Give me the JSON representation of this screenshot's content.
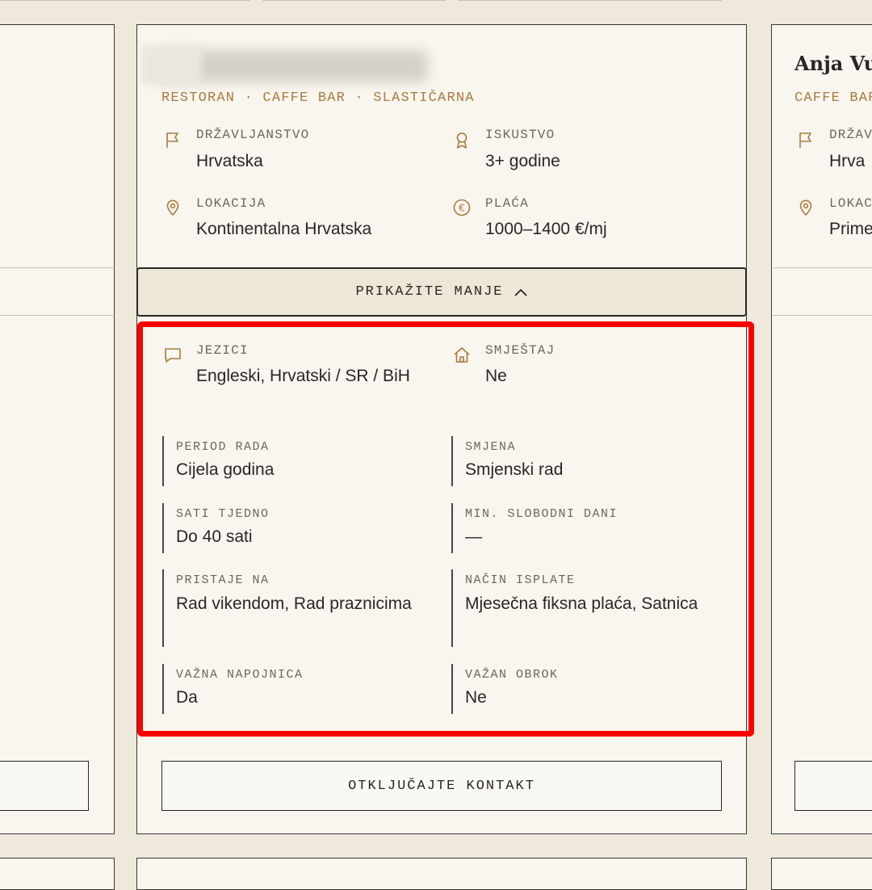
{
  "center_card": {
    "categories": "RESTORAN · CAFFE BAR · SLASTIČARNA",
    "summary_fields": [
      {
        "label": "DRŽAVLJANSTVO",
        "value": "Hrvatska",
        "icon": "flag-icon"
      },
      {
        "label": "ISKUSTVO",
        "value": "3+ godine",
        "icon": "award-icon"
      },
      {
        "label": "LOKACIJA",
        "value": "Kontinentalna Hrvatska",
        "icon": "map-pin-icon"
      },
      {
        "label": "PLAĆA",
        "value": "1000–1400 €/mj",
        "icon": "euro-icon"
      }
    ],
    "toggle_label": "PRIKAŽITE MANJE",
    "expanded": {
      "icon_fields": [
        {
          "label": "JEZICI",
          "value": "Engleski, Hrvatski / SR / BiH",
          "icon": "chat-icon"
        },
        {
          "label": "SMJEŠTAJ",
          "value": "Ne",
          "icon": "home-icon"
        }
      ],
      "details": [
        {
          "label": "PERIOD RADA",
          "value": "Cijela godina"
        },
        {
          "label": "SMJENA",
          "value": "Smjenski rad"
        },
        {
          "label": "SATI TJEDNO",
          "value": "Do 40 sati"
        },
        {
          "label": "MIN. SLOBODNI DANI",
          "value": "—"
        },
        {
          "label": "PRISTAJE NA",
          "value": "Rad vikendom, Rad praznicima"
        },
        {
          "label": "NAČIN ISPLATE",
          "value": "Mjesečna fiksna plaća, Satnica"
        },
        {
          "label": "VAŽNA NAPOJNICA",
          "value": "Da"
        },
        {
          "label": "VAŽAN OBROK",
          "value": "Ne"
        }
      ]
    },
    "unlock_label": "OTKLJUČAJTE KONTAKT"
  },
  "right_card": {
    "name": "Anja Vu",
    "categories": "CAFFE BAR",
    "fields": [
      {
        "label": "DRŽAV",
        "value": "Hrva",
        "icon": "flag-icon"
      },
      {
        "label": "LOKAC",
        "value": "Prime",
        "icon": "map-pin-icon"
      }
    ]
  },
  "colors": {
    "accent": "#a97a3c",
    "highlight": "#ff0000",
    "page_bg": "#efe9dc",
    "card_bg": "#f9f6ef"
  }
}
